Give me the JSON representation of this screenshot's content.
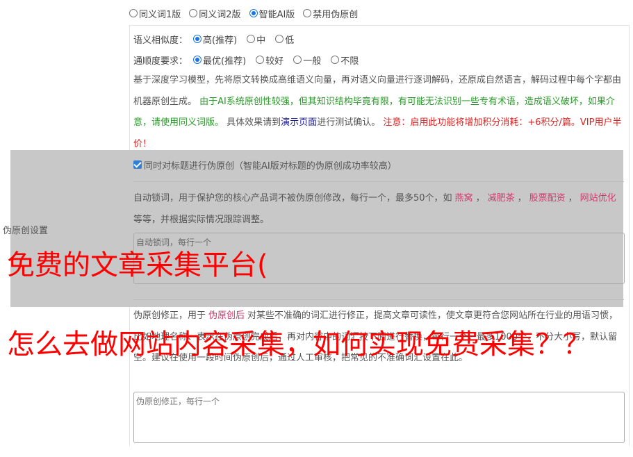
{
  "version_options": [
    {
      "label": "同义词1版",
      "checked": false
    },
    {
      "label": "同义词2版",
      "checked": false
    },
    {
      "label": "智能AI版",
      "checked": true
    },
    {
      "label": "禁用伪原创",
      "checked": false
    }
  ],
  "similarity": {
    "label": "语义相似度：",
    "options": [
      {
        "label": "高(推荐)",
        "checked": true
      },
      {
        "label": "中",
        "checked": false
      },
      {
        "label": "低",
        "checked": false
      }
    ]
  },
  "fluency": {
    "label": "通顺度要求：",
    "options": [
      {
        "label": "最优(推荐)",
        "checked": true
      },
      {
        "label": "较好",
        "checked": false
      },
      {
        "label": "一般",
        "checked": false
      },
      {
        "label": "不限",
        "checked": false
      }
    ]
  },
  "description": {
    "part1": "基于深度学习模型，先将原文转换成高维语义向量，再对语义向量进行逐词解码，还原成自然语言，解码过程中每个字都由机器原创生成。",
    "part2_green": "由于AI系统原创性较强，但其知识结构毕竟有限，有可能无法识别一些专有术语，造成语义破坏，如果介意，请使用同义词版。",
    "part3": "具体效果请到",
    "demo_link": "演示页面",
    "part4": "进行测试确认。",
    "part5_red": "注意：启用此功能将增加积分消耗：+6积分/篇。VIP用户半价！"
  },
  "title_checkbox": {
    "label": "同时对标题进行伪原创（智能AI版对标题的伪原创成功率较高）",
    "checked": true
  },
  "lock_words": {
    "text_before": "自动锁词，用于保护您的核心产品词不被伪原创修改，每行一个，最多50个，如",
    "examples": [
      "燕窝",
      "减肥茶",
      "股票配资",
      "网站优化"
    ],
    "text_after": "等等，并根据实际情况跟踪调整。",
    "placeholder": "自动锁词，每行一个"
  },
  "side_label": "伪原创设置",
  "correction": {
    "text_before": "伪原创修正，用于",
    "tag": "伪原创后",
    "text_after": "对某些不准确的词汇进行修正，提高文章可读性，使文章更符合您网站所在行业的用语习惯，比如地理名称、表示在伪原创完成后，再对内容中的词汇按下面进行替换，每行一个，最多1000个，不分大小写，默认留空。建议在使用一段时间伪原创后，通过人工审核，把常见的不准确词汇设置在此。",
    "placeholder": "伪原创修正，每行一个"
  },
  "overlay": {
    "line1": "免费的文章采集平台(",
    "line2": "怎么去做网站内容采集，如何实现免费采集？？"
  },
  "colors": {
    "accent": "#1a73e8",
    "overlay_text": "#ff0000",
    "green_text": "#2a9b2a",
    "red_text": "#e02020",
    "tag_text": "#d23a6e",
    "gray_overlay": "#c8c8c8"
  }
}
